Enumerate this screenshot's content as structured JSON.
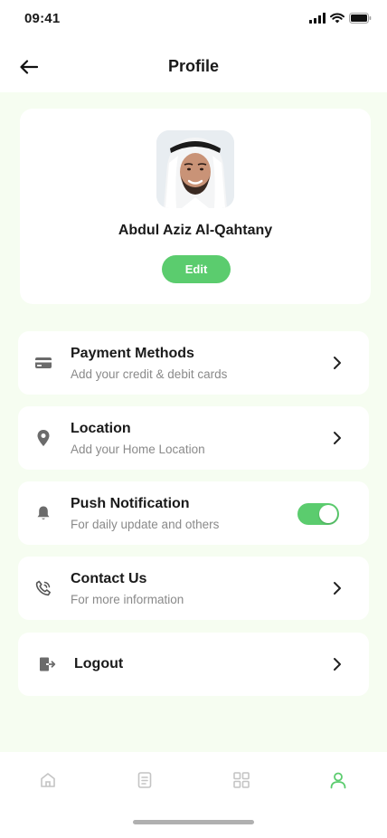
{
  "status_bar": {
    "time": "09:41"
  },
  "header": {
    "title": "Profile"
  },
  "profile": {
    "name": "Abdul Aziz Al-Qahtany",
    "edit_label": "Edit"
  },
  "menu": [
    {
      "title": "Payment Methods",
      "subtitle": "Add your credit & debit cards",
      "icon": "card-icon"
    },
    {
      "title": "Location",
      "subtitle": "Add your Home Location",
      "icon": "location-pin-icon"
    },
    {
      "title": "Push Notification",
      "subtitle": "For daily update and others",
      "icon": "bell-icon",
      "toggle_on": true
    },
    {
      "title": "Contact Us",
      "subtitle": "For more information",
      "icon": "phone-icon"
    },
    {
      "title": "Logout",
      "icon": "logout-icon"
    }
  ],
  "bottom_nav": [
    {
      "name": "home",
      "icon": "home-icon"
    },
    {
      "name": "documents",
      "icon": "document-icon"
    },
    {
      "name": "apps",
      "icon": "grid-icon"
    },
    {
      "name": "profile",
      "icon": "person-icon",
      "active": true
    }
  ],
  "colors": {
    "accent": "#5bcc6e",
    "background": "#f6fdf1",
    "card": "#ffffff",
    "subtitle": "#8a8a8a",
    "nav_inactive": "#c4c4c4"
  }
}
